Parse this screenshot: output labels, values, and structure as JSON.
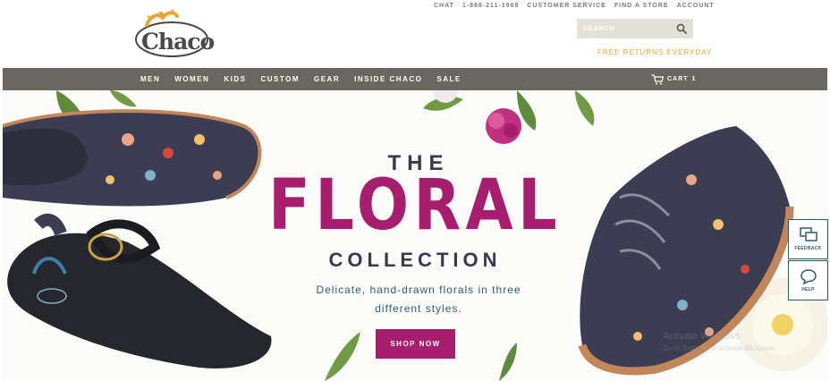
{
  "header": {
    "logo_text": "Chaco",
    "utility_nav": [
      "CHAT",
      "1-888-211-1908",
      "CUSTOMER SERVICE",
      "FIND A STORE",
      "ACCOUNT"
    ],
    "search_placeholder": "SEARCH",
    "free_returns": "FREE RETURNS EVERYDAY"
  },
  "nav": {
    "items": [
      "MEN",
      "WOMEN",
      "KIDS",
      "CUSTOM",
      "GEAR",
      "INSIDE CHACO",
      "SALE"
    ],
    "cart_label": "CART",
    "cart_count": "1"
  },
  "hero": {
    "title_top": "THE",
    "title_main": "FLORAL",
    "title_bottom": "COLLECTION",
    "description": "Delicate, hand-drawn florals in three different styles.",
    "cta_label": "SHOP NOW",
    "watermark_line1": "Activate Windows",
    "watermark_line2": "Go to Settings to activate Windows."
  },
  "side_widgets": {
    "feedback_label": "FEEDBACK",
    "help_label": "HELP"
  },
  "colors": {
    "accent": "#a81e6e",
    "nav_bg": "#6a6760",
    "gold": "#e8a530",
    "dark_text": "#3a3b4a",
    "teal": "#2b5b6b"
  }
}
